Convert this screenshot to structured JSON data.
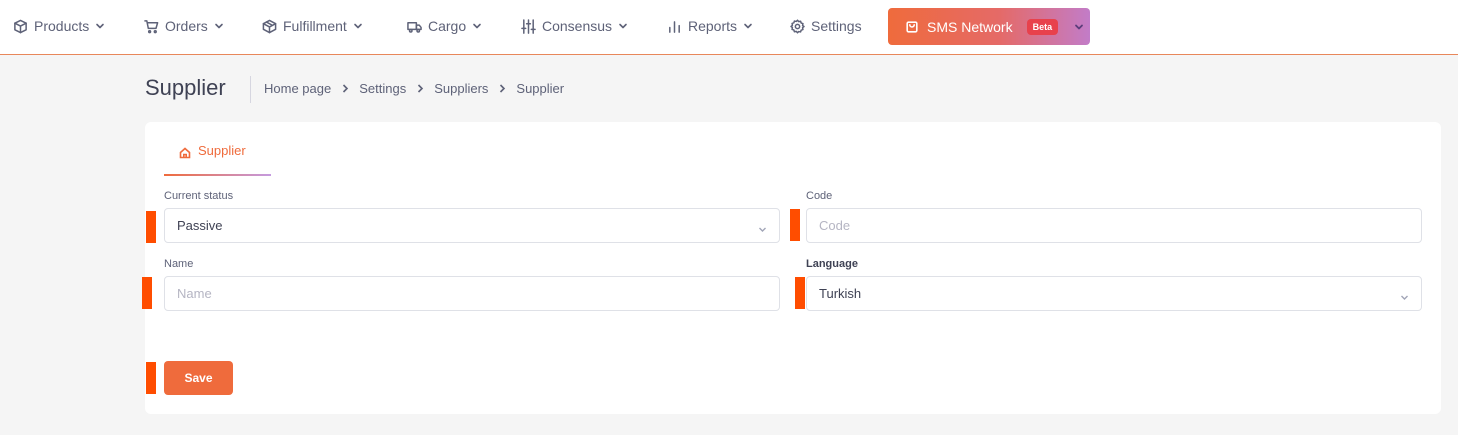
{
  "nav": {
    "products": "Products",
    "orders": "Orders",
    "fulfillment": "Fulfillment",
    "cargo": "Cargo",
    "consensus": "Consensus",
    "reports": "Reports",
    "settings": "Settings",
    "sms_network": "SMS Network",
    "beta_badge": "Beta"
  },
  "page": {
    "title": "Supplier",
    "breadcrumb": [
      "Home page",
      "Settings",
      "Suppliers",
      "Supplier"
    ]
  },
  "tab": {
    "label": "Supplier"
  },
  "form": {
    "current_status_label": "Current status",
    "current_status_value": "Passive",
    "code_label": "Code",
    "code_placeholder": "Code",
    "name_label": "Name",
    "name_placeholder": "Name",
    "language_label": "Language",
    "language_value": "Turkish",
    "save_label": "Save"
  },
  "colors": {
    "accent": "#ef6b3c",
    "marker": "#ff4d00",
    "badge": "#e8414c"
  }
}
